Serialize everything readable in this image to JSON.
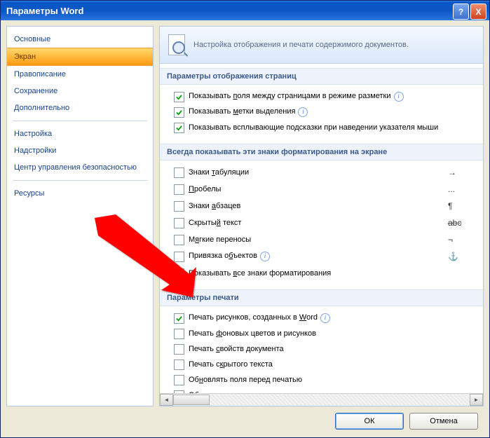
{
  "title": "Параметры Word",
  "sidebar": {
    "items": [
      {
        "label": "Основные"
      },
      {
        "label": "Экран"
      },
      {
        "label": "Правописание"
      },
      {
        "label": "Сохранение"
      },
      {
        "label": "Дополнительно"
      },
      {
        "label": "Настройка"
      },
      {
        "label": "Надстройки"
      },
      {
        "label": "Центр управления безопасностью"
      },
      {
        "label": "Ресурсы"
      }
    ],
    "active_index": 1
  },
  "header_text": "Настройка отображения и печати содержимого документов.",
  "sections": {
    "page_display": {
      "title": "Параметры отображения страниц",
      "items": [
        {
          "checked": true,
          "pre": "Показывать ",
          "u": "п",
          "post": "оля между страницами в режиме разметки",
          "info": true
        },
        {
          "checked": true,
          "pre": "Показывать ",
          "u": "м",
          "post": "етки выделения",
          "info": true
        },
        {
          "checked": true,
          "pre": "Показывать всплывающие подсказки при наведении указателя мыши",
          "u": "",
          "post": "",
          "info": false
        }
      ]
    },
    "formatting": {
      "title": "Всегда показывать эти знаки форматирования на экране",
      "items": [
        {
          "checked": false,
          "pre": "Знаки ",
          "u": "т",
          "post": "абуляции",
          "sym": "→"
        },
        {
          "checked": false,
          "pre": "",
          "u": "П",
          "post": "робелы",
          "sym": "..."
        },
        {
          "checked": false,
          "pre": "Знаки ",
          "u": "а",
          "post": "бзацев",
          "sym": "¶"
        },
        {
          "checked": false,
          "pre": "Скрыты",
          "u": "й",
          "post": " текст",
          "sym": "abc",
          "strike": true
        },
        {
          "checked": false,
          "pre": "М",
          "u": "я",
          "post": "гкие переносы",
          "sym": "¬"
        },
        {
          "checked": false,
          "pre": "Привязка о",
          "u": "б",
          "post": "ъектов",
          "sym": "⚓",
          "info": true
        },
        {
          "checked": false,
          "pre": "Показывать ",
          "u": "в",
          "post": "се знаки форматирования",
          "sym": ""
        }
      ]
    },
    "printing": {
      "title": "Параметры печати",
      "items": [
        {
          "checked": true,
          "pre": "Печать рисунков, созданных в ",
          "u": "W",
          "post": "ord",
          "info": true
        },
        {
          "checked": false,
          "pre": "Печать ",
          "u": "ф",
          "post": "оновых цветов и рисунков"
        },
        {
          "checked": false,
          "pre": "Печать ",
          "u": "с",
          "post": "войств документа"
        },
        {
          "checked": false,
          "pre": "Печать с",
          "u": "к",
          "post": "рытого текста"
        },
        {
          "checked": false,
          "pre": "Об",
          "u": "н",
          "post": "овлять поля перед печатью"
        },
        {
          "checked": false,
          "pre": "",
          "u": "О",
          "post": "бновлять связанные данные перед печатью"
        }
      ]
    }
  },
  "buttons": {
    "ok": "ОК",
    "cancel": "Отмена"
  },
  "titlebar": {
    "help": "?",
    "close": "X"
  }
}
